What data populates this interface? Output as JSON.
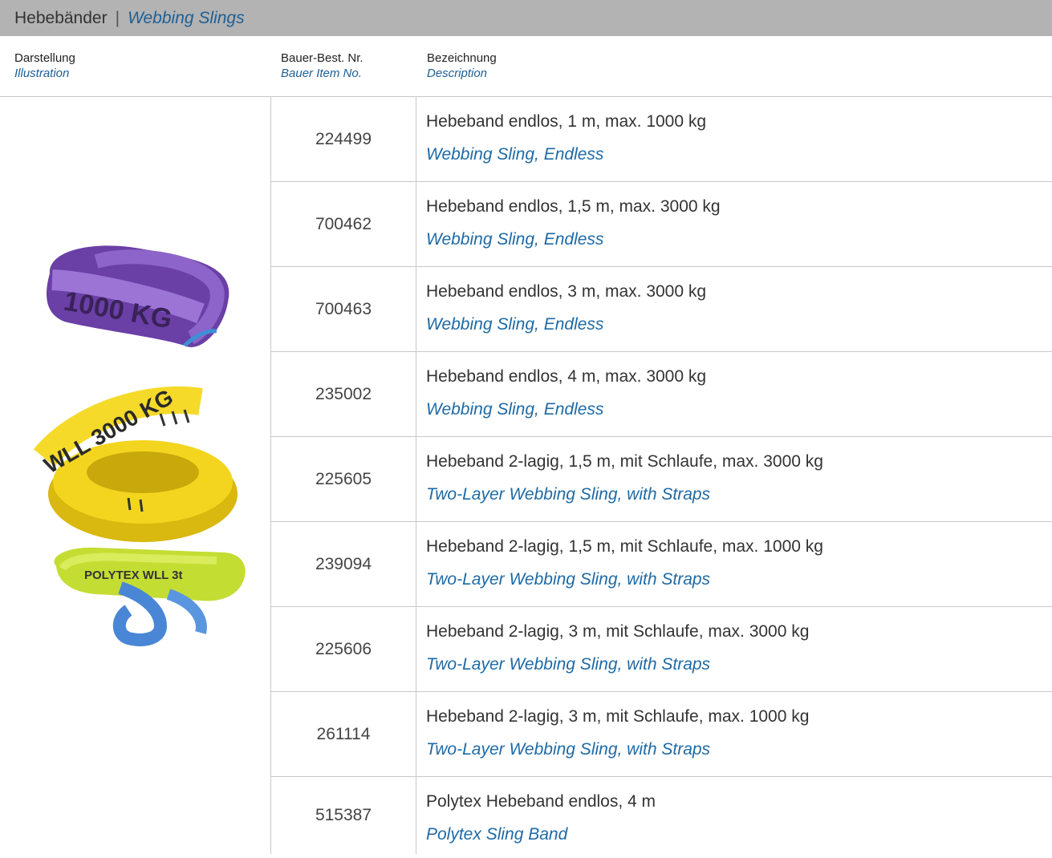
{
  "title": {
    "de": "Hebebänder",
    "separator": "|",
    "en": "Webbing Slings"
  },
  "columns": [
    {
      "de": "Darstellung",
      "en": "Illustration"
    },
    {
      "de": "Bauer-Best. Nr.",
      "en": "Bauer Item No."
    },
    {
      "de": "Bezeichnung",
      "en": "Description"
    }
  ],
  "images": [
    {
      "name": "purple-endless-sling",
      "label": "1000 KG",
      "color": "#7b4fb5"
    },
    {
      "name": "yellow-endless-sling",
      "label": "WLL 3000 KG",
      "color": "#f2d21b"
    },
    {
      "name": "polytex-sling",
      "label": "POLYTEX WLL 3t",
      "color": "#c9e34a",
      "accent": "#4f8fd9"
    }
  ],
  "rows": [
    {
      "item_no": "224499",
      "de": "Hebeband endlos, 1 m, max. 1000 kg",
      "en": "Webbing Sling, Endless"
    },
    {
      "item_no": "700462",
      "de": "Hebeband endlos, 1,5 m, max. 3000 kg",
      "en": "Webbing Sling, Endless"
    },
    {
      "item_no": "700463",
      "de": "Hebeband endlos, 3 m, max. 3000 kg",
      "en": "Webbing Sling, Endless"
    },
    {
      "item_no": "235002",
      "de": "Hebeband endlos, 4 m, max. 3000 kg",
      "en": "Webbing Sling, Endless"
    },
    {
      "item_no": "225605",
      "de": "Hebeband 2-lagig, 1,5 m, mit Schlaufe, max. 3000 kg",
      "en": "Two-Layer Webbing Sling, with Straps"
    },
    {
      "item_no": "239094",
      "de": "Hebeband 2-lagig, 1,5 m, mit Schlaufe, max. 1000 kg",
      "en": "Two-Layer Webbing Sling, with Straps"
    },
    {
      "item_no": "225606",
      "de": "Hebeband 2-lagig, 3 m, mit Schlaufe, max. 3000 kg",
      "en": "Two-Layer Webbing Sling, with Straps"
    },
    {
      "item_no": "261114",
      "de": "Hebeband 2-lagig, 3 m, mit Schlaufe, max. 1000 kg",
      "en": "Two-Layer Webbing Sling, with Straps"
    },
    {
      "item_no": "515387",
      "de": "Polytex Hebeband endlos, 4 m",
      "en": "Polytex Sling Band"
    }
  ]
}
